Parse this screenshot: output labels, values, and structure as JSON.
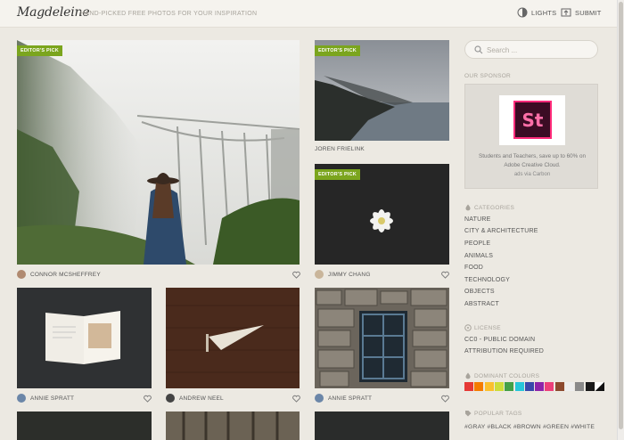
{
  "header": {
    "logo": "Magdeleine",
    "tagline": "HAND-PICKED FREE PHOTOS FOR YOUR INSPIRATION",
    "lights_label": "LIGHTS",
    "submit_label": "SUBMIT"
  },
  "photos": [
    {
      "badge": "EDITOR'S PICK",
      "author": "CONNOR MCSHEFFREY"
    },
    {
      "badge": "EDITOR'S PICK",
      "author": "JOREN FRIELINK"
    },
    {
      "badge": "EDITOR'S PICK",
      "author": "JIMMY CHANG"
    },
    {
      "badge": "",
      "author": "ANNIE SPRATT"
    },
    {
      "badge": "",
      "author": "ANDREW NEEL"
    },
    {
      "badge": "",
      "author": "ANNIE SPRATT"
    }
  ],
  "sidebar": {
    "search_placeholder": "Search ...",
    "sponsor_heading": "OUR SPONSOR",
    "sponsor_logo_text": "St",
    "sponsor_text": "Students and Teachers, save up to 60% on Adobe Creative Cloud.",
    "sponsor_via": "ads via Carbon",
    "categories_heading": "CATEGORIES",
    "categories": [
      "NATURE",
      "CITY & ARCHITECTURE",
      "PEOPLE",
      "ANIMALS",
      "FOOD",
      "TECHNOLOGY",
      "OBJECTS",
      "ABSTRACT"
    ],
    "license_heading": "LICENSE",
    "licenses": [
      "CC0 - PUBLIC DOMAIN",
      "ATTRIBUTION REQUIRED"
    ],
    "colours_heading": "DOMINANT COLOURS",
    "colours": [
      "#e53935",
      "#f57c00",
      "#fbc02d",
      "#cddc39",
      "#43a047",
      "#26c6da",
      "#3949ab",
      "#8e24aa",
      "#ec407a",
      "#8d4a2f",
      "#eeeeee",
      "#8a8a8a",
      "#1a1a1a"
    ],
    "tags_heading": "POPULAR TAGS",
    "tags": "#GRAY  #BLACK  #BROWN  #GREEN  #WHITE"
  }
}
